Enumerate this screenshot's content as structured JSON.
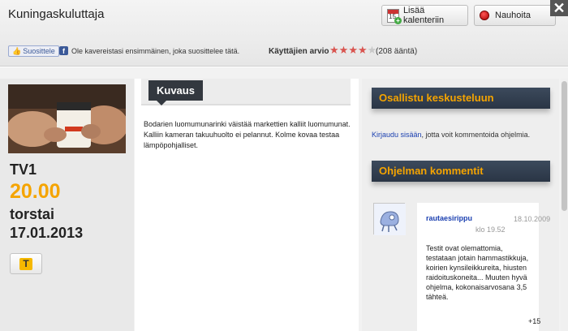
{
  "header": {
    "title": "Kuningaskuluttaja",
    "add_to_calendar": "Lisää kalenteriin",
    "calendar_day": "15",
    "record": "Nauhoita",
    "close_symbol": "✕"
  },
  "social": {
    "like_label": "Suosittele",
    "like_text": "Ole kavereistasi ensimmäinen, joka suosittelee tätä."
  },
  "rating": {
    "label": "Käyttäjien arvio",
    "stars": 4,
    "max_stars": 5,
    "count_text": "(208 ääntä)"
  },
  "program": {
    "channel": "TV1",
    "time": "20.00",
    "weekday": "torstai",
    "date": "17.01.2013",
    "badge": "T"
  },
  "description": {
    "tab_label": "Kuvaus",
    "text": "Bodarien luomumunarinki väistää markettien kalliit luomumunat. Kalliin kameran takuuhuolto ei pelannut. Kolme kovaa testaa lämpöpohjalliset."
  },
  "discussion": {
    "join_title": "Osallistu keskusteluun",
    "login_link": "Kirjaudu sisään",
    "login_suffix": ", jotta voit kommentoida ohjelmia.",
    "comments_title": "Ohjelman kommentit",
    "comments": [
      {
        "author": "rautaesirippu",
        "date": "18.10.2009 klo 19.52",
        "text": "Testit ovat olemattomia, testataan jotain hammastikkuja, koirien kynsileikkureita, hiusten raidoituskoneita... Muuten hyvä ohjelma, kokonaisarvosana 3,5 tähteä.",
        "votes": "+15"
      }
    ]
  },
  "colors": {
    "accent": "#f5a400",
    "header_bar": "#2a3545",
    "link": "#1a3fb0",
    "star_on": "#d9544f"
  }
}
